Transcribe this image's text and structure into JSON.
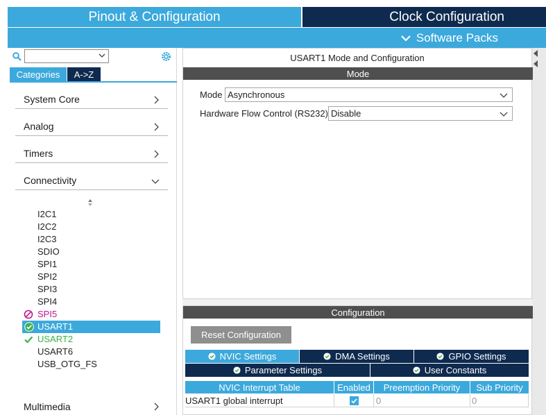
{
  "tabs": {
    "pinout": "Pinout & Configuration",
    "clock": "Clock Configuration",
    "packs": "Software Packs"
  },
  "left": {
    "search": {
      "value": "",
      "placeholder": ""
    },
    "view_tabs": {
      "categories": "Categories",
      "az": "A->Z"
    },
    "categories": [
      {
        "label": "System Core"
      },
      {
        "label": "Analog"
      },
      {
        "label": "Timers"
      },
      {
        "label": "Connectivity"
      },
      {
        "label": "Multimedia"
      }
    ],
    "connectivity_items": [
      {
        "label": "I2C1",
        "state": "normal"
      },
      {
        "label": "I2C2",
        "state": "normal"
      },
      {
        "label": "I2C3",
        "state": "normal"
      },
      {
        "label": "SDIO",
        "state": "normal"
      },
      {
        "label": "SPI1",
        "state": "normal"
      },
      {
        "label": "SPI2",
        "state": "normal"
      },
      {
        "label": "SPI3",
        "state": "normal"
      },
      {
        "label": "SPI4",
        "state": "normal"
      },
      {
        "label": "SPI5",
        "state": "disabled"
      },
      {
        "label": "USART1",
        "state": "selected"
      },
      {
        "label": "USART2",
        "state": "configured"
      },
      {
        "label": "USART6",
        "state": "normal"
      },
      {
        "label": "USB_OTG_FS",
        "state": "normal"
      }
    ]
  },
  "main": {
    "title": "USART1 Mode and Configuration",
    "mode_header": "Mode",
    "mode_label": "Mode",
    "mode_value": "Asynchronous",
    "flow_label": "Hardware Flow Control (RS232)",
    "flow_value": "Disable",
    "config_header": "Configuration",
    "reset_button": "Reset Configuration",
    "config_tabs": {
      "nvic": "NVIC Settings",
      "dma": "DMA Settings",
      "gpio": "GPIO Settings",
      "param": "Parameter Settings",
      "user": "User Constants"
    },
    "table": {
      "headers": [
        "NVIC Interrupt Table",
        "Enabled",
        "Preemption Priority",
        "Sub Priority"
      ],
      "rows": [
        {
          "name": "USART1 global interrupt",
          "enabled": true,
          "preemption": "0",
          "sub": "0"
        }
      ]
    }
  },
  "colors": {
    "accent": "#3ca9dc",
    "navy": "#0e2a4f",
    "header_grey": "#4f4f4f",
    "disabled": "#c0148c",
    "ok": "#3bb24a"
  }
}
